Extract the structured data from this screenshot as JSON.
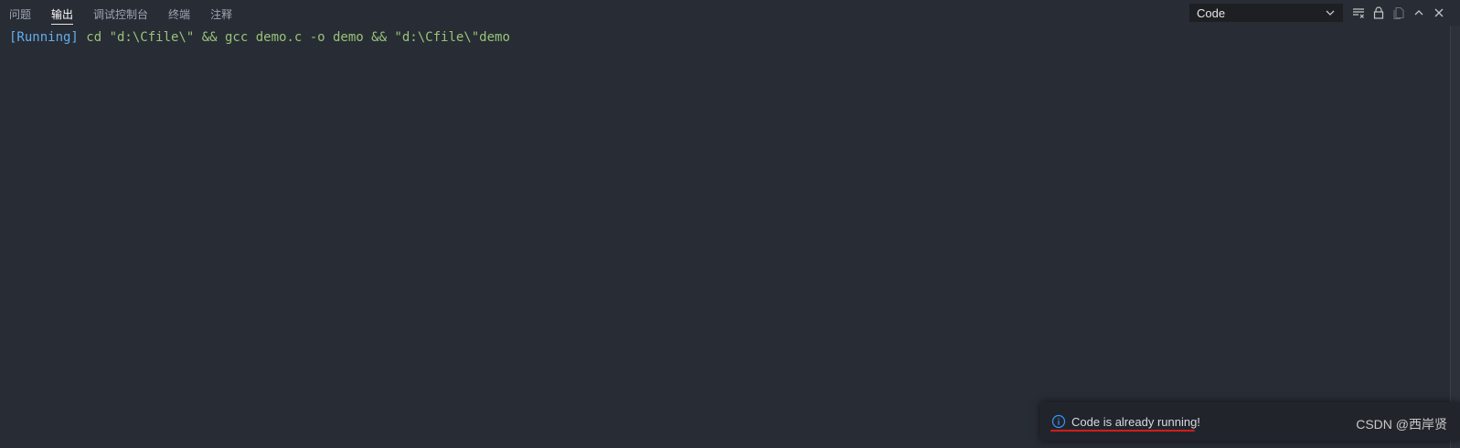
{
  "tabs": [
    {
      "label": "问题",
      "active": false
    },
    {
      "label": "输出",
      "active": true
    },
    {
      "label": "调试控制台",
      "active": false
    },
    {
      "label": "终端",
      "active": false
    },
    {
      "label": "注释",
      "active": false
    }
  ],
  "toolbar": {
    "output_channel": "Code",
    "icons": [
      "chevron-down-icon",
      "clear-output-icon",
      "lock-icon",
      "copy-icon",
      "chevron-up-icon",
      "close-icon"
    ]
  },
  "output": {
    "status_tag": "[Running]",
    "command": " cd \"d:\\Cfile\\\" && gcc demo.c -o demo && \"d:\\Cfile\\\"demo"
  },
  "notification": {
    "icon": "info-icon",
    "message": "Code is already running!"
  },
  "watermark": "CSDN @西岸贤",
  "colors": {
    "background": "#282c34",
    "output_text": "#98c379",
    "status_tag": "#61afef",
    "info_icon": "#3794ff",
    "annotation_underline": "#d41b1b"
  }
}
